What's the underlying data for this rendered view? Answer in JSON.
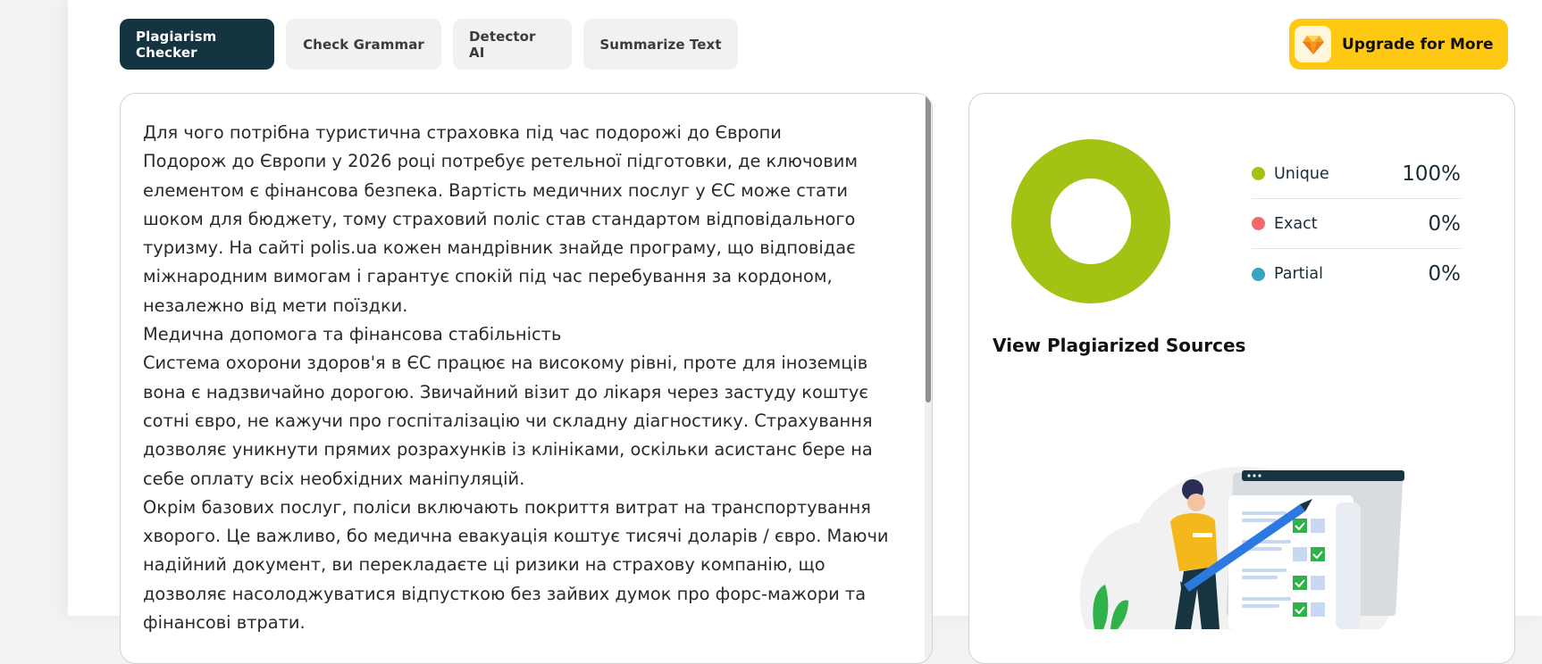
{
  "tabs": [
    {
      "label": "Plagiarism Checker",
      "active": true
    },
    {
      "label": "Check Grammar",
      "active": false
    },
    {
      "label": "Detector AI",
      "active": false
    },
    {
      "label": "Summarize Text",
      "active": false
    }
  ],
  "upgrade": {
    "label": "Upgrade for More",
    "icon": "diamond-icon"
  },
  "editor": {
    "paragraphs": [
      "Для чого потрібна туристична страховка під час подорожі до Європи",
      "Подорож до Європи у 2026 році потребує ретельної підготовки, де ключовим елементом є фінансова безпека. Вартість медичних послуг у ЄС може стати шоком для бюджету, тому страховий поліс став стандартом відповідального туризму. На сайті polis.ua кожен мандрівник знайде програму, що відповідає міжнародним вимогам і гарантує спокій під час перебування за кордоном, незалежно від мети поїздки.",
      "Медична допомога та фінансова стабільність",
      "Система охорони здоров'я в ЄС працює на високому рівні, проте для іноземців вона є надзвичайно дорогою. Звичайний візит до лікаря через застуду коштує сотні євро, не кажучи про госпіталізацію чи складну діагностику. Страхування дозволяє уникнути прямих розрахунків із клініками, оскільки асистанс бере на себе оплату всіх необхідних маніпуляцій.",
      "Окрім базових послуг, поліси включають покриття витрат на транспортування хворого. Це важливо, бо медична евакуація коштує тисячі доларів / євро. Маючи надійний документ, ви перекладаєте ці ризики на страхову компанію, що дозволяє насолоджуватися відпусткою без зайвих думок про форс-мажори та фінансові втрати."
    ]
  },
  "results": {
    "stats": [
      {
        "label": "Unique",
        "value": "100%",
        "color": "#a2c314"
      },
      {
        "label": "Exact",
        "value": "0%",
        "color": "#f2696b"
      },
      {
        "label": "Partial",
        "value": "0%",
        "color": "#36a5c4"
      }
    ],
    "donut_colors": {
      "unique": "#a2c314"
    },
    "sources_title": "View Plagiarized Sources",
    "illustration": "checklist-illustration"
  }
}
